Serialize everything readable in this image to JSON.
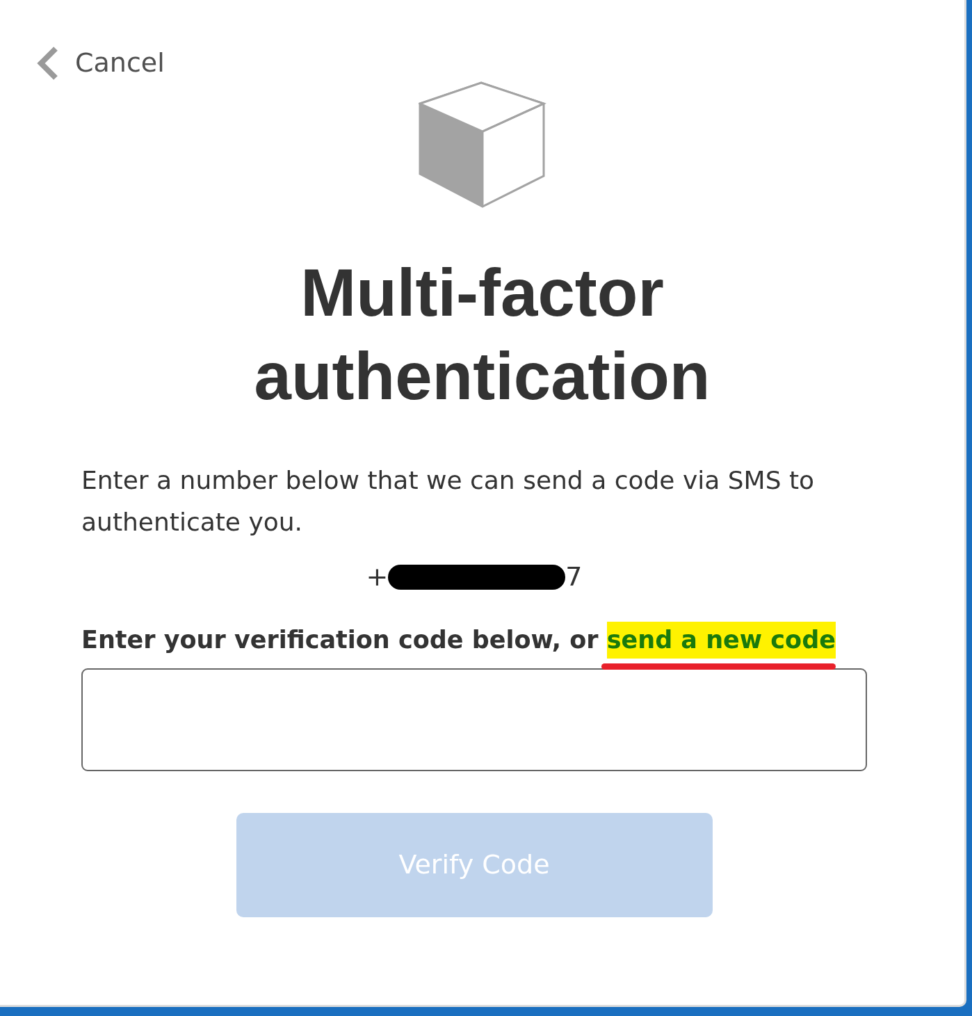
{
  "cancel": {
    "label": "Cancel"
  },
  "title": "Multi-factor authentication",
  "intro": "Enter a number below that we can send a code via SMS to authenticate you.",
  "phone": {
    "prefix": "+",
    "suffix": "7",
    "redacted": true
  },
  "code_prompt": {
    "text": "Enter your verification code below, or",
    "link": "send a new code",
    "highlighted": true,
    "underlined": true
  },
  "code_field": {
    "disabled": false
  },
  "verify_button": {
    "label": "Verify Code",
    "disabled": true
  }
}
